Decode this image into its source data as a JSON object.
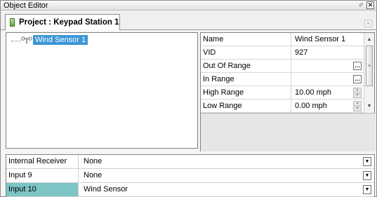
{
  "window": {
    "title": "Object Editor"
  },
  "tab": {
    "label": "Project : Keypad Station 1"
  },
  "tree": {
    "selected_item": "Wind Sensor 1",
    "item_icon": "sensor-tree-icon"
  },
  "properties": {
    "rows": [
      {
        "name": "Name",
        "value": "Wind Sensor 1",
        "editor": "text"
      },
      {
        "name": "VID",
        "value": "927",
        "editor": "text"
      },
      {
        "name": "Out Of Range",
        "value": "",
        "editor": "ellipsis"
      },
      {
        "name": "In Range",
        "value": "",
        "editor": "ellipsis"
      },
      {
        "name": "High Range",
        "value": "10.00 mph",
        "editor": "spin"
      },
      {
        "name": "Low Range",
        "value": "0.00 mph",
        "editor": "spin"
      }
    ],
    "ellipsis_text": "…"
  },
  "io": {
    "rows": [
      {
        "label": "Internal Receiver",
        "value": "None",
        "selected": false
      },
      {
        "label": "Input 9",
        "value": "None",
        "selected": false
      },
      {
        "label": "Input 10",
        "value": "Wind Sensor",
        "selected": true
      }
    ],
    "selected_color": "#7dc4c4"
  },
  "colors": {
    "selection": "#3c96d6",
    "io_selected": "#7dc4c4"
  }
}
